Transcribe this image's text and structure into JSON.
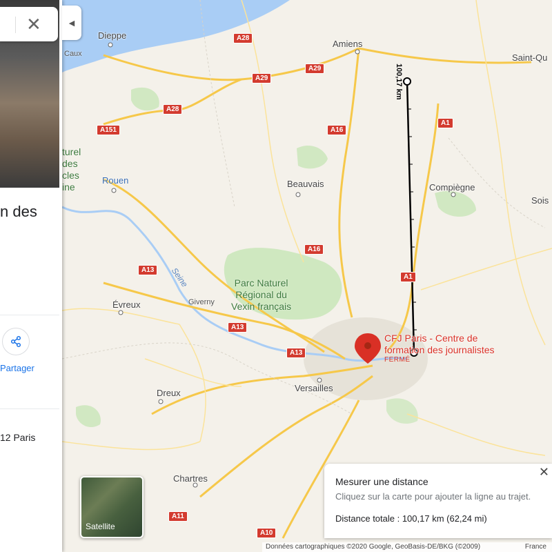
{
  "map": {
    "cities": [
      "Dieppe",
      "Amiens",
      "Saint-Qu",
      "Rouen",
      "Beauvais",
      "Compiègne",
      "Sois",
      "Évreux",
      "Giverny",
      "Versailles",
      "Dreux",
      "Chartres",
      "Caux"
    ],
    "park_line1": "Parc Naturel",
    "park_line2": "Régional du",
    "park_line3": "Vexin français",
    "river": "Seine",
    "river_fragment_lines": [
      "turel",
      "des",
      "cles",
      "ine"
    ],
    "roads": [
      "A28",
      "A29",
      "A29",
      "A28",
      "A151",
      "A16",
      "A1",
      "A16",
      "A13",
      "A1",
      "A13",
      "A13",
      "A11",
      "A10"
    ],
    "poi": {
      "name_line1": "CFJ Paris - Centre de",
      "name_line2": "formation des journalistes",
      "status": "FERMÉ",
      "color": "#d93025"
    },
    "measure_label": "100,17 km"
  },
  "panel": {
    "title_fragment": "n des",
    "share_label": "Partager",
    "address_fragment": "12 Paris"
  },
  "satellite_label": "Satellite",
  "measure_card": {
    "title": "Mesurer une distance",
    "subtitle": "Cliquez sur la carte pour ajouter la ligne au trajet.",
    "total": "Distance totale : 100,17 km (62,24 mi)"
  },
  "footer": {
    "attribution": "Données cartographiques ©2020 Google, GeoBasis-DE/BKG (©2009)",
    "region": "France"
  },
  "colors": {
    "road_shield": "#d33b2f",
    "link_blue": "#1a73e8",
    "park_green": "#c8e6b8",
    "sea": "#a9cdf5"
  }
}
